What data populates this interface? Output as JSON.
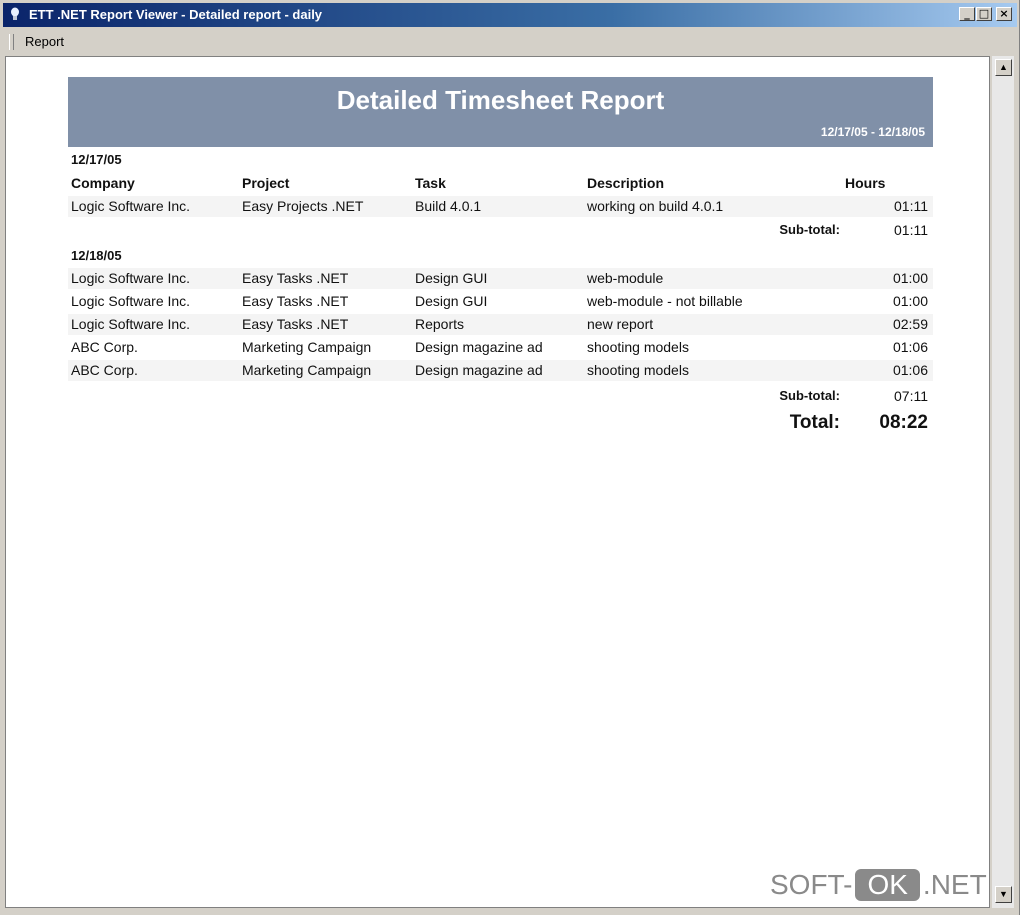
{
  "window": {
    "title": "ETT .NET Report Viewer - Detailed report - daily",
    "minimize": "_",
    "maximize": "□",
    "close": "×"
  },
  "menu": {
    "report": "Report"
  },
  "report": {
    "title": "Detailed Timesheet Report",
    "range": "12/17/05 - 12/18/05",
    "columns": {
      "company": "Company",
      "project": "Project",
      "task": "Task",
      "description": "Description",
      "hours": "Hours"
    },
    "groups": [
      {
        "date": "12/17/05",
        "rows": [
          {
            "company": "Logic Software Inc.",
            "project": "Easy Projects .NET",
            "task": "Build 4.0.1",
            "description": "working on build 4.0.1",
            "hours": "01:11"
          }
        ],
        "subtotal_label": "Sub-total:",
        "subtotal": "01:11"
      },
      {
        "date": "12/18/05",
        "rows": [
          {
            "company": "Logic Software Inc.",
            "project": "Easy Tasks .NET",
            "task": "Design GUI",
            "description": "web-module",
            "hours": "01:00"
          },
          {
            "company": "Logic Software Inc.",
            "project": "Easy Tasks .NET",
            "task": "Design GUI",
            "description": "web-module - not billable",
            "hours": "01:00"
          },
          {
            "company": "Logic Software Inc.",
            "project": "Easy Tasks .NET",
            "task": "Reports",
            "description": "new report",
            "hours": "02:59"
          },
          {
            "company": "ABC Corp.",
            "project": "Marketing Campaign",
            "task": "Design magazine ad",
            "description": "shooting models",
            "hours": "01:06"
          },
          {
            "company": "ABC Corp.",
            "project": "Marketing Campaign",
            "task": "Design magazine ad",
            "description": "shooting models",
            "hours": "01:06"
          }
        ],
        "subtotal_label": "Sub-total:",
        "subtotal": "07:11"
      }
    ],
    "total_label": "Total:",
    "total": "08:22"
  },
  "watermark": {
    "left": "SOFT-",
    "mid": "OK",
    "right": ".NET"
  },
  "colors": {
    "banner": "#8090a8",
    "titlebar": "#0a246a"
  }
}
